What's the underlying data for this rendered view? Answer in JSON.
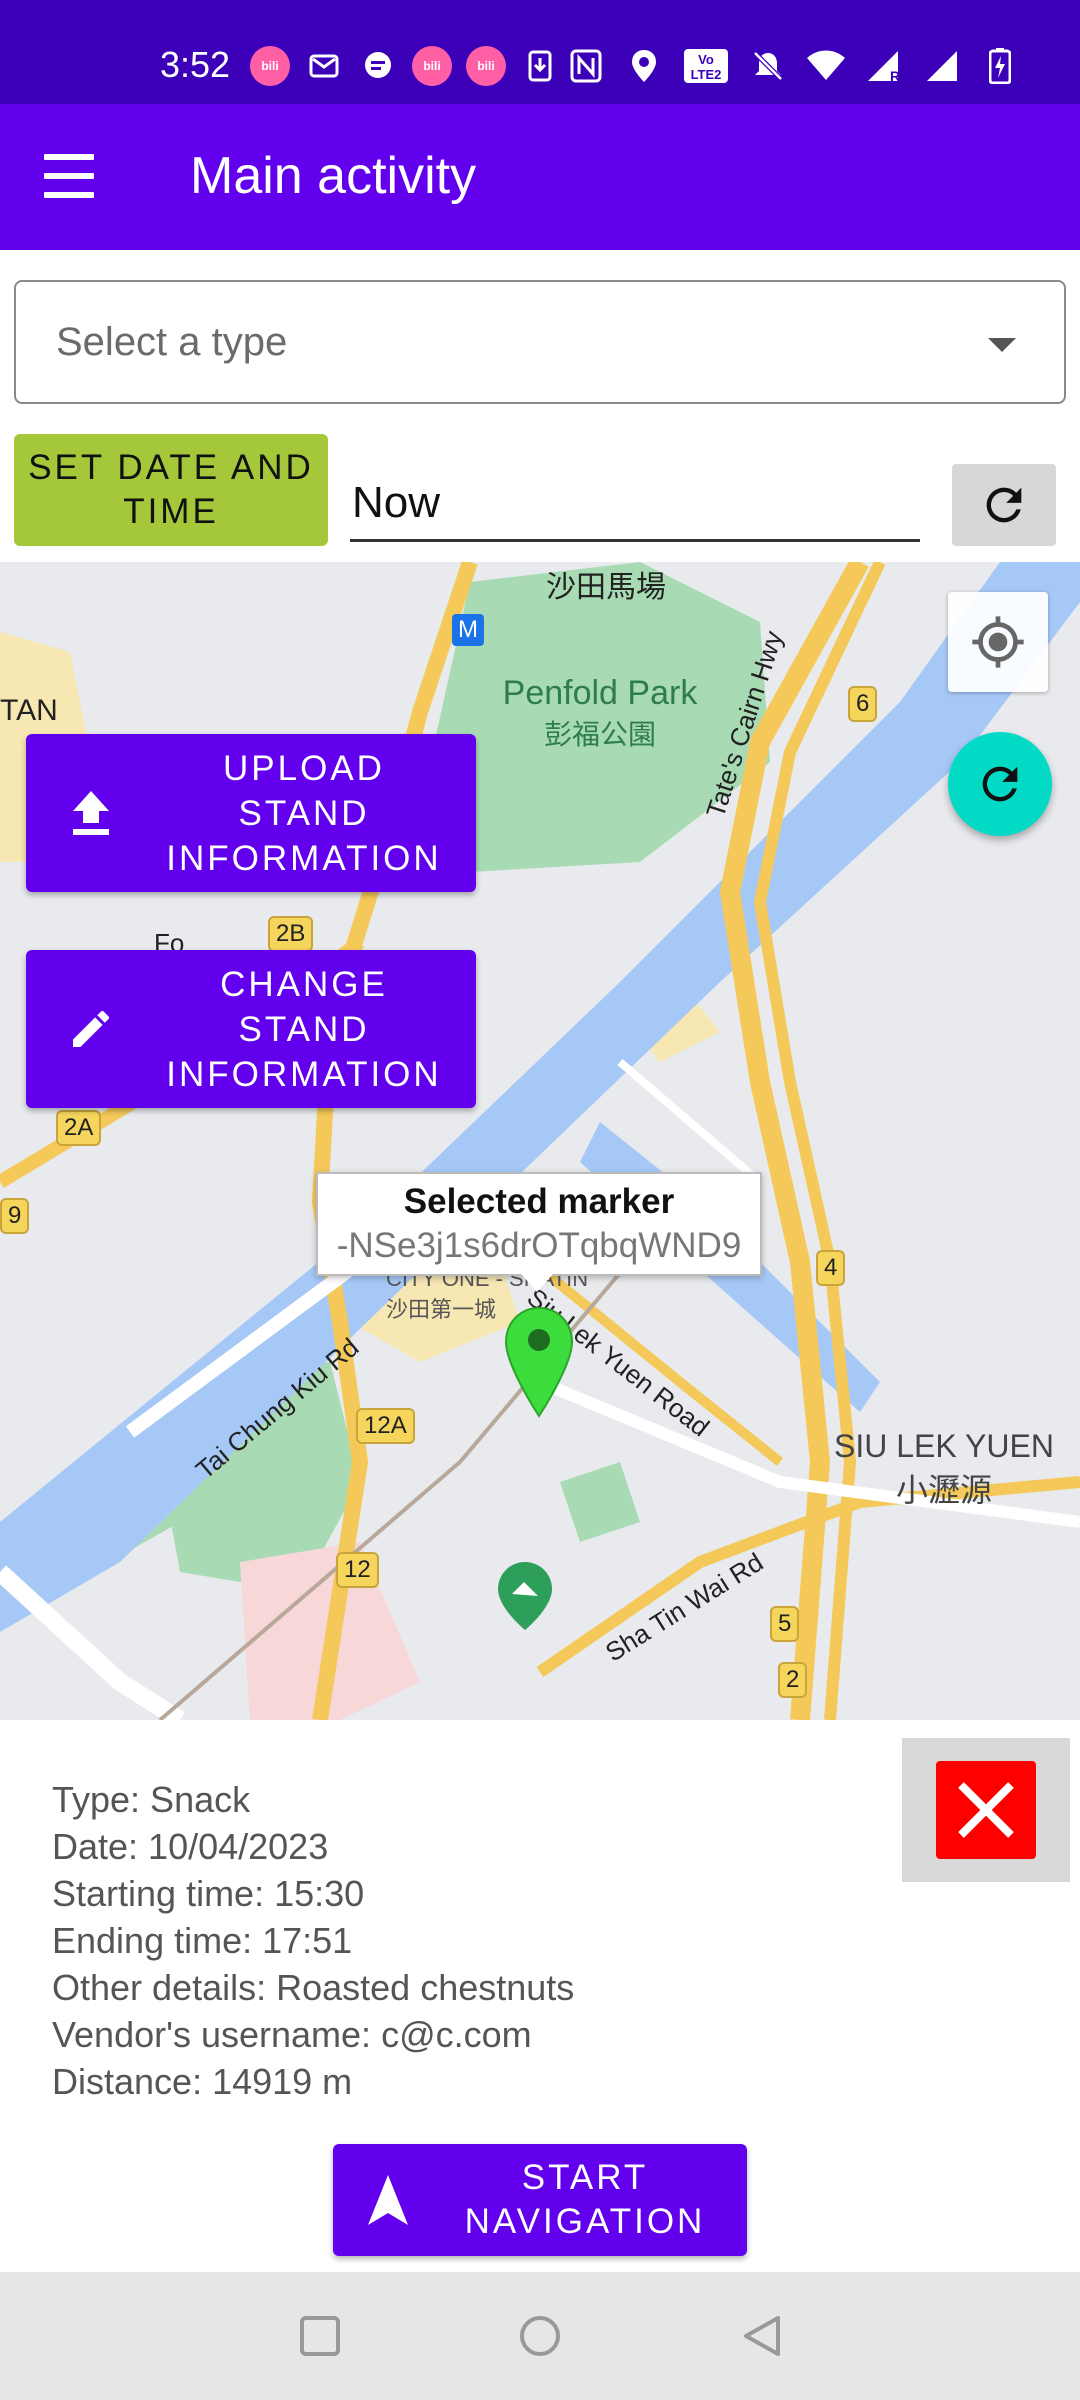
{
  "status_bar": {
    "time": "3:52",
    "notification_icons": [
      "bilibili-icon",
      "mail-icon",
      "chat-icon",
      "bilibili-icon",
      "bilibili-icon",
      "download-icon"
    ],
    "system_icons": [
      "nfc-icon",
      "location-icon",
      "volte-icon",
      "mute-icon",
      "wifi-icon",
      "signal-roaming-icon",
      "signal-icon",
      "battery-charging-icon"
    ],
    "volte_text": "Vo LTE2",
    "roaming_text": "R",
    "bilibili_text": "bili"
  },
  "app_bar": {
    "title": "Main activity",
    "background": "#6200ee"
  },
  "type_select": {
    "placeholder": "Select a type"
  },
  "date_row": {
    "button_label": "SET DATE AND TIME",
    "value": "Now"
  },
  "map": {
    "upload_button_label": "UPLOAD STAND INFORMATION",
    "change_button_label": "CHANGE STAND INFORMATION",
    "info_window": {
      "title": "Selected marker",
      "snippet": "-NSe3j1s6drOTqbqWND9"
    },
    "labels": {
      "park_en": "Penfold Park",
      "park_zh": "彭福公園",
      "racecourse_zh": "沙田馬場",
      "tan": "TAN",
      "siu_lek_yuen_en": "SIU LEK YUEN",
      "siu_lek_yuen_zh": "小瀝源",
      "tates_cairn": "Tate's Cairn Hwy",
      "tai_chung_kiu": "Tai Chung Kiu Rd",
      "siu_lek_yuen_road": "Siu Lek Yuen Road",
      "sha_tin_wai": "Sha Tin Wai Rd",
      "city_one": "CITY ONE - SHATIN",
      "city_one_zh": "沙田第一城",
      "fo": "Fo",
      "metro": "M"
    },
    "shields": [
      "6",
      "2B",
      "2A",
      "9",
      "4",
      "12A",
      "12",
      "5",
      "2"
    ]
  },
  "details": {
    "type": "Type: Snack",
    "date": "Date: 10/04/2023",
    "start": "Starting time: 15:30",
    "end": "Ending time: 17:51",
    "other": "Other details: Roasted chestnuts",
    "vendor": "Vendor's username: c@c.com",
    "distance": "Distance: 14919 m"
  },
  "navigation_button": {
    "label": "START NAVIGATION"
  },
  "colors": {
    "primary": "#6200ee",
    "status_bar": "#3b00b8",
    "accent_teal": "#03dac5",
    "date_button": "#a5c83a",
    "close_red": "#ff0000",
    "marker_green": "#3ddc3d"
  }
}
